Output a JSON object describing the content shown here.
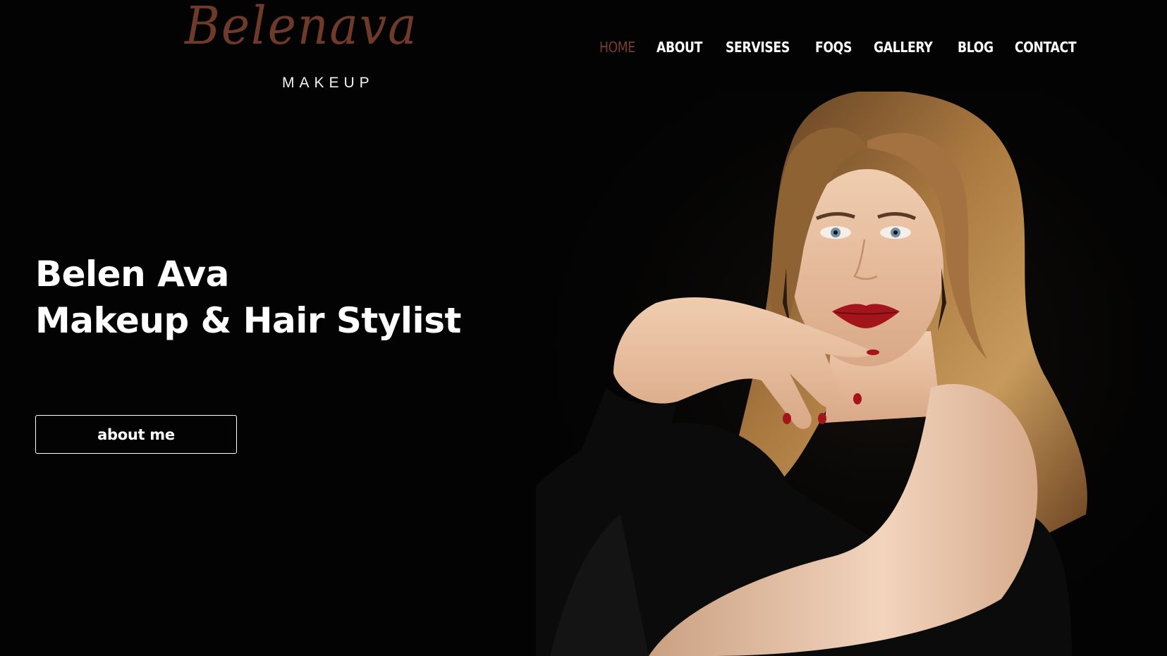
{
  "brand": {
    "script_text": "Belenava",
    "sub_text": "MAKEUP",
    "color": "#6f3a29"
  },
  "nav": {
    "items": [
      {
        "label": "HOME",
        "active": true
      },
      {
        "label": "ABOUT",
        "active": false
      },
      {
        "label": "SERVISES",
        "active": false
      },
      {
        "label": "FOQS",
        "active": false
      },
      {
        "label": "GALLERY",
        "active": false
      },
      {
        "label": "BLOG",
        "active": false
      },
      {
        "label": "CONTACT",
        "active": false
      }
    ],
    "active_color": "#7a3e2d"
  },
  "hero": {
    "title_line1": "Belen Ava",
    "title_line2": "Makeup & Hair Stylist",
    "cta_label": "about me",
    "image_subject": "portrait of a woman with long wavy hair, red lips, black top"
  },
  "colors": {
    "background": "#030303",
    "text": "#ffffff"
  }
}
